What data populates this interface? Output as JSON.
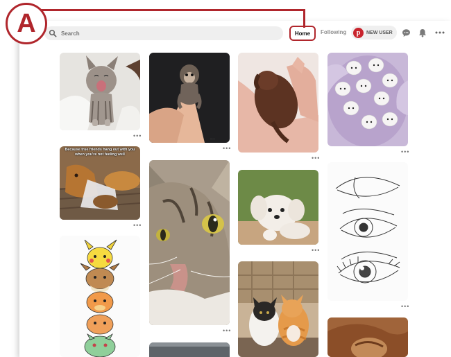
{
  "annotation": {
    "label": "A",
    "color": "#b0262c"
  },
  "topbar": {
    "search_placeholder": "Search",
    "home_label": "Home",
    "following_label": "Following",
    "user_label": "NEW USER",
    "brand_letter": "p",
    "brand_color": "#c8232c"
  },
  "pins": [
    {
      "name": "pin-yawning-kitten",
      "subject": "kitten"
    },
    {
      "name": "pin-baby-monkey",
      "subject": "monkey"
    },
    {
      "name": "pin-puppy-in-hand",
      "subject": "puppy"
    },
    {
      "name": "pin-white-kittens-basket",
      "subject": "kittens"
    },
    {
      "name": "pin-dog-cone-meme",
      "subject": "meme",
      "caption": "Because true friends hang out with you when you're not feeling well"
    },
    {
      "name": "pin-tabby-cat-closeup",
      "subject": "cat"
    },
    {
      "name": "pin-white-puppy",
      "subject": "puppy"
    },
    {
      "name": "pin-eye-drawing",
      "subject": "drawing"
    },
    {
      "name": "pin-pokemon-stack",
      "subject": "cartoon"
    },
    {
      "name": "pin-two-cats",
      "subject": "cats"
    },
    {
      "name": "pin-partial-gray",
      "subject": "partial"
    },
    {
      "name": "pin-partial-cat",
      "subject": "partial"
    }
  ],
  "more_glyph": "•••"
}
